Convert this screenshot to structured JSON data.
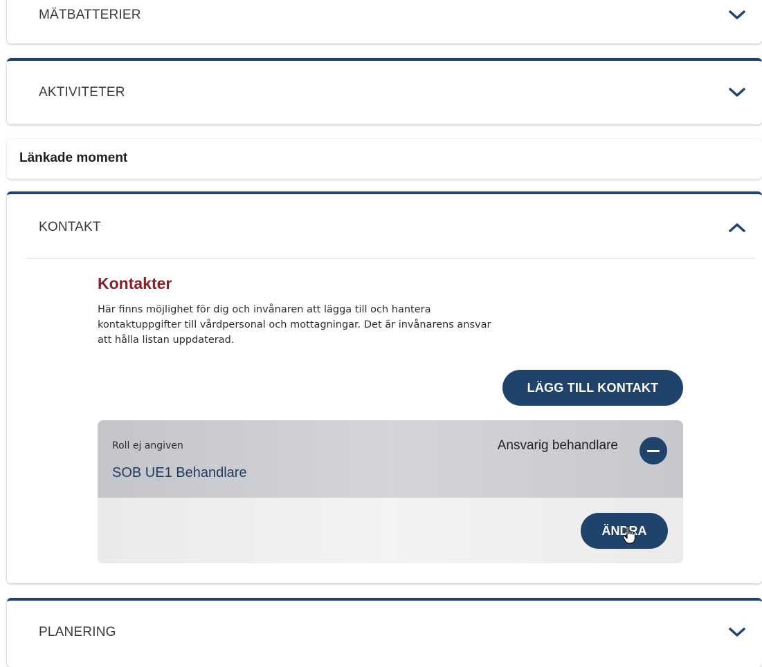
{
  "sections": {
    "matbatterier": {
      "title": "MÄTBATTERIER",
      "expanded": false
    },
    "aktiviteter": {
      "title": "AKTIVITETER",
      "expanded": false
    },
    "lankade_moment": {
      "title": "Länkade moment"
    },
    "kontakt": {
      "title": "KONTAKT",
      "expanded": true,
      "heading": "Kontakter",
      "description": "Här finns möjlighet för dig och invånaren att lägga till och hantera kontaktuppgifter till vårdpersonal och mottagningar. Det är invånarens ansvar att hålla listan uppdaterad.",
      "add_button": "LÄGG TILL KONTAKT",
      "contacts": [
        {
          "role": "Roll ej angiven",
          "name": "SOB UE1 Behandlare",
          "tag": "Ansvarig behandlare",
          "edit_button": "ÄNDRA"
        }
      ]
    },
    "planering": {
      "title": "PLANERING",
      "expanded": false
    }
  },
  "colors": {
    "primary": "#20436b",
    "heading_accent": "#8a1f2c",
    "card_top": "#cbcdd2",
    "card_bottom": "#eeeeef"
  },
  "icons": {
    "expand": "chevron-down-icon",
    "collapse": "chevron-up-icon",
    "remove": "minus-circle-icon",
    "cursor": "hand-pointer-icon"
  }
}
